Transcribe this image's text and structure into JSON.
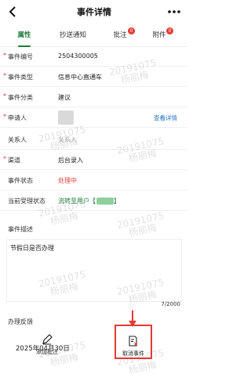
{
  "header": {
    "title": "事件详情"
  },
  "tabs": [
    {
      "label": "属性",
      "badge": ""
    },
    {
      "label": "抄送通知",
      "badge": ""
    },
    {
      "label": "批注",
      "badge": "0"
    },
    {
      "label": "附件",
      "badge": "0"
    }
  ],
  "fields": {
    "event_no": {
      "label": "事件编号",
      "value": "2504300005"
    },
    "event_type": {
      "label": "事件类型",
      "value": "信息中心直通车"
    },
    "event_category": {
      "label": "事件分类",
      "value": "建议"
    },
    "applicant": {
      "label": "申请人",
      "link": "查看详情"
    },
    "contact": {
      "label": "关系人",
      "placeholder": "关系人"
    },
    "channel": {
      "label": "渠道",
      "value": "后台录入"
    },
    "status": {
      "label": "事件状态",
      "value": "处理中"
    },
    "current_status": {
      "label": "当前受理状态",
      "value": "流转至用户【",
      "suffix": "】"
    }
  },
  "description": {
    "label": "事件描述",
    "text": "节假日是否办理",
    "counter": "7/2000"
  },
  "feedback": {
    "label": "办理反馈",
    "date": "2025年04月30日"
  },
  "actions": {
    "add_note": "添加批注",
    "cancel_event": "取消事件"
  },
  "watermark": {
    "line1": "20191075",
    "line2": "杨丽梅"
  },
  "colors": {
    "accent": "#1e7a3a",
    "danger": "#e53935",
    "link": "#1f6fbf"
  }
}
